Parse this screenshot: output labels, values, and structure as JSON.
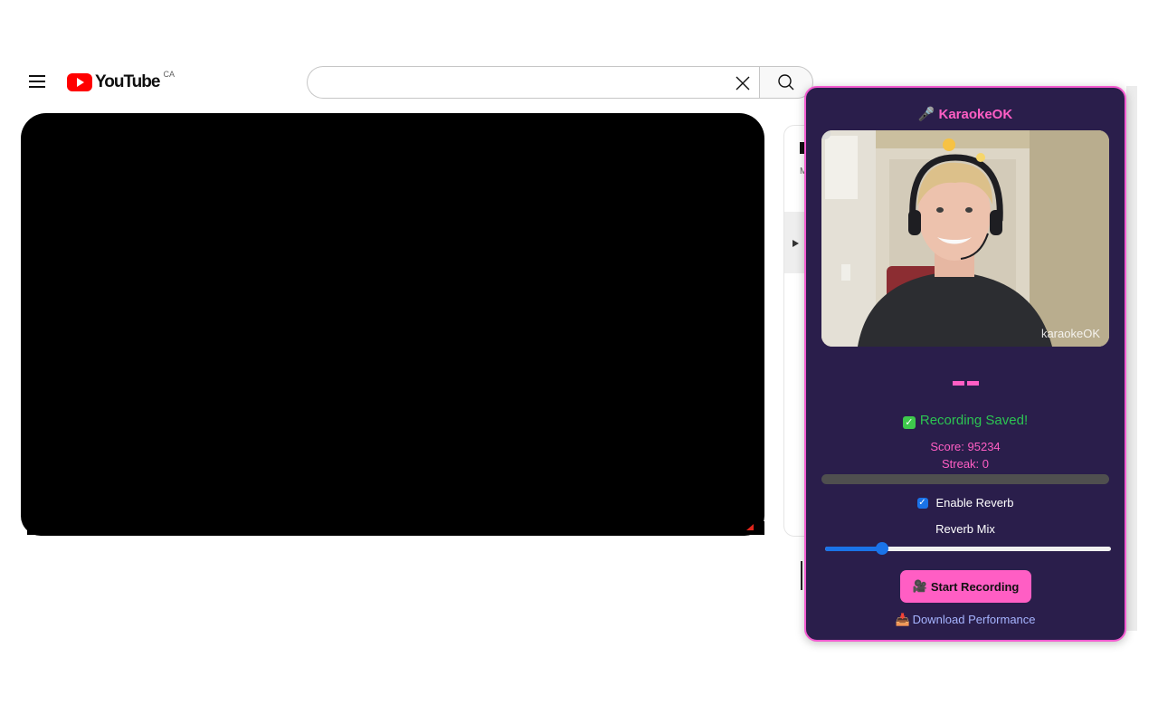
{
  "youtube": {
    "logo_text": "YouTube",
    "country_code": "CA",
    "search": {
      "value": "",
      "placeholder": ""
    }
  },
  "karaoke": {
    "title_icon": "🎤",
    "title": "KaraokeOK",
    "camera_watermark": "karaokeOK",
    "pitch_indicator": "--",
    "status_icon": "✓",
    "status_text": "Recording Saved!",
    "score_text": "Score: 95234",
    "streak_text": "Streak: 0",
    "progress": 0,
    "reverb_enabled": true,
    "reverb_label": "Enable Reverb",
    "reverb_mix_label": "Reverb Mix",
    "reverb_mix_value": 0.2,
    "start_icon": "🎥",
    "start_label": "Start Recording",
    "download_icon": "📥",
    "download_label": "Download Performance"
  },
  "colors": {
    "youtube_red": "#ff0000",
    "panel_bg": "#2a1e4b",
    "accent_pink": "#ff5ec4",
    "status_green": "#2cc452",
    "link_blue": "#a6b4ff",
    "control_blue": "#1a73e8"
  },
  "icons": {
    "menu": "hamburger-icon",
    "clear": "close-icon",
    "search": "search-icon",
    "mic": "microphone-icon",
    "status": "checkmark-icon",
    "start": "video-camera-icon",
    "download": "download-tray-icon"
  }
}
